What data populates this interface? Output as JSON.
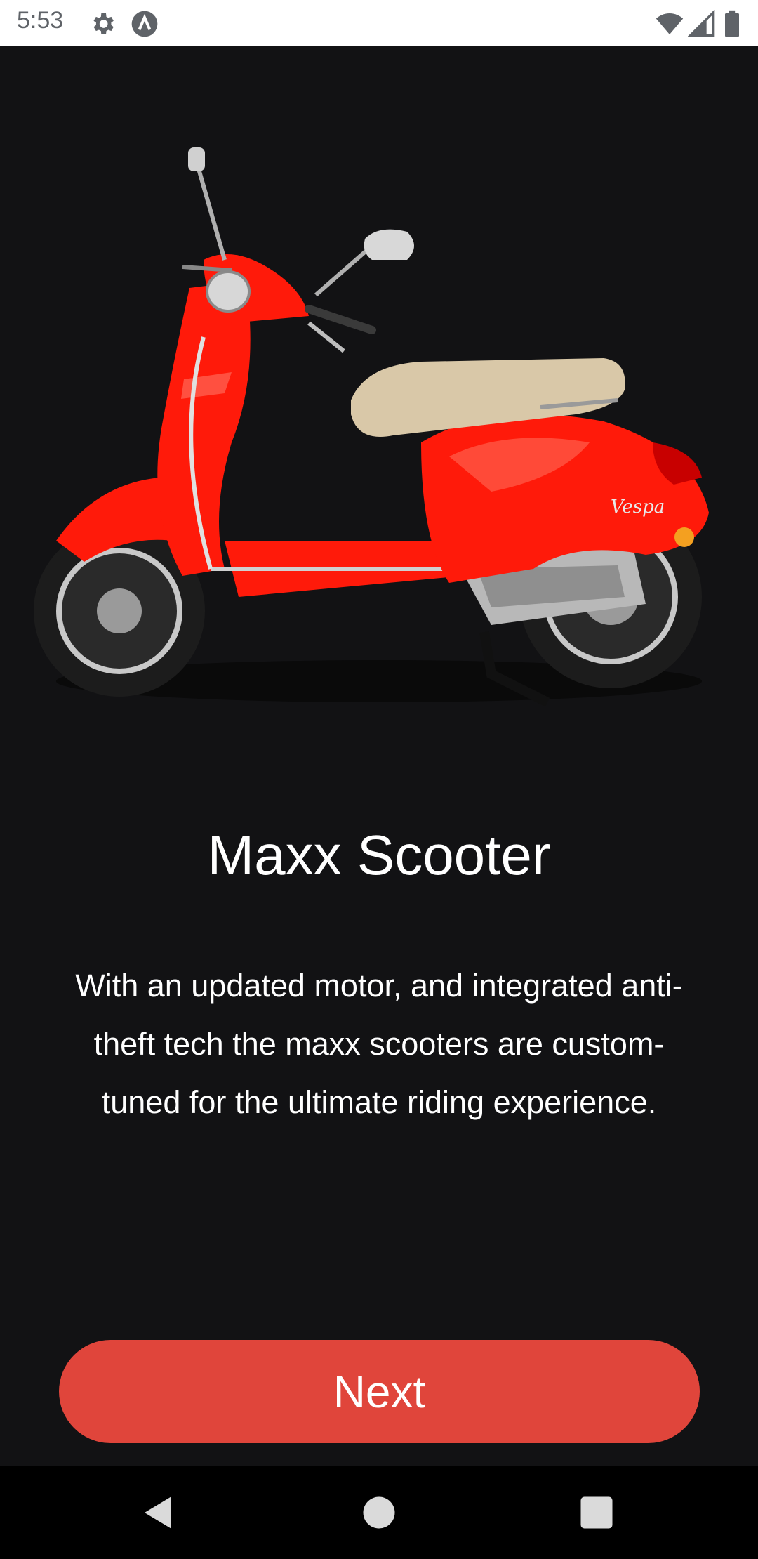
{
  "status_bar": {
    "time": "5:53",
    "icons": [
      "settings-gear-icon",
      "app-notification-icon",
      "wifi-icon",
      "cellular-signal-icon",
      "battery-icon"
    ]
  },
  "hero": {
    "image_description_icon": "scooter-image",
    "colors": {
      "body": "#ff1a0a",
      "seat": "#d9c8a8",
      "tire": "#1c1c1c",
      "chrome": "#bfbfbf"
    }
  },
  "content": {
    "title": "Maxx Scooter",
    "description": "With an updated motor, and integrated anti-theft tech the maxx scooters are custom-tuned for the ultimate riding experience."
  },
  "actions": {
    "next_label": "Next"
  },
  "colors": {
    "background": "#121214",
    "accent": "#e0453b",
    "text": "#ffffff"
  },
  "nav_bar": {
    "icons": [
      "back-icon",
      "home-icon",
      "recents-icon"
    ]
  }
}
